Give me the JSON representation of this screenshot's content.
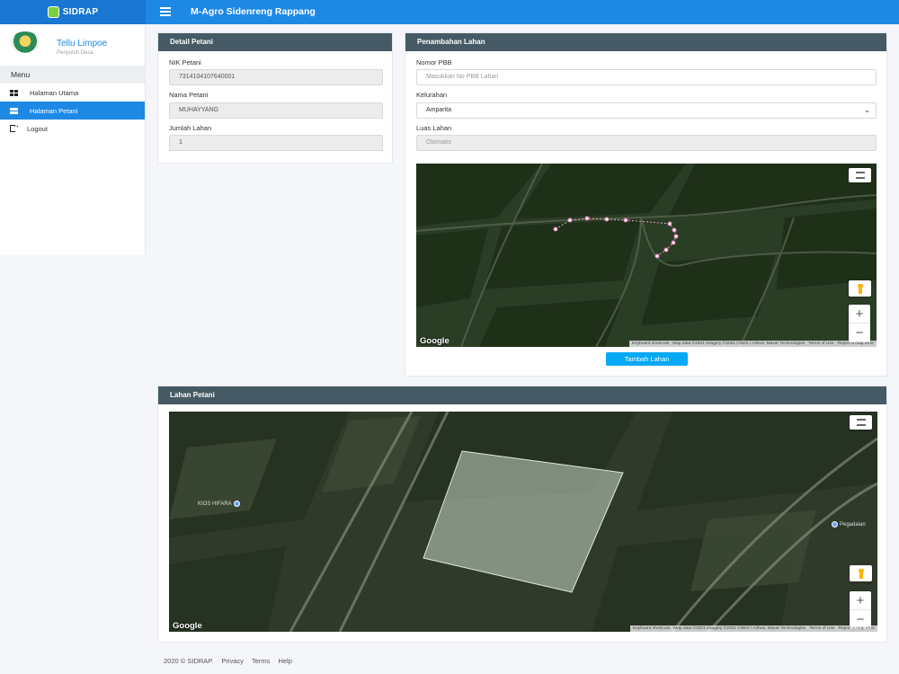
{
  "brand": {
    "name": "SIDRAP"
  },
  "header": {
    "title": "M-Agro Sidenreng Rappang"
  },
  "user": {
    "name": "Tellu Limpoe",
    "role": "Penyuluh Desa"
  },
  "sidebar": {
    "menu_label": "Menu",
    "items": [
      {
        "label": "Halaman Utama",
        "icon": "dashboard-icon",
        "active": false
      },
      {
        "label": "Halaman Petani",
        "icon": "list-icon",
        "active": true
      },
      {
        "label": "Logout",
        "icon": "logout-icon",
        "active": false
      }
    ]
  },
  "detail_petani": {
    "title": "Detail Petani",
    "nik_label": "NIK Petani",
    "nik_value": "7314104107640001",
    "nama_label": "Nama Petani",
    "nama_value": "MUHAYYANG",
    "jumlah_label": "Jumlah Lahan",
    "jumlah_value": "1"
  },
  "penambahan_lahan": {
    "title": "Penambahan Lahan",
    "pbb_label": "Nomor PBB",
    "pbb_placeholder": "Masukkan No PBB Lahan",
    "kelurahan_label": "Kelurahan",
    "kelurahan_value": "Amparita",
    "luas_label": "Luas Lahan",
    "luas_value": "Otomatis",
    "submit_label": "Tambah Lahan"
  },
  "map_common": {
    "google": "Google",
    "attribution": [
      "Keyboard shortcuts",
      "Map data ©2021 Imagery ©2021 CNES / Airbus, Maxar Technologies",
      "Terms of Use",
      "Report a map error"
    ]
  },
  "lahan_petani": {
    "title": "Lahan Petani",
    "poi_1": "KIOS HIFARA",
    "poi_2": "Pegadaian"
  },
  "footer": {
    "copyright": "2020 © SIDRAP.",
    "links": [
      "Privacy",
      "Terms",
      "Help"
    ]
  },
  "colors": {
    "primary": "#1e88e5",
    "card_header": "#455a64",
    "button": "#03a9f4"
  }
}
